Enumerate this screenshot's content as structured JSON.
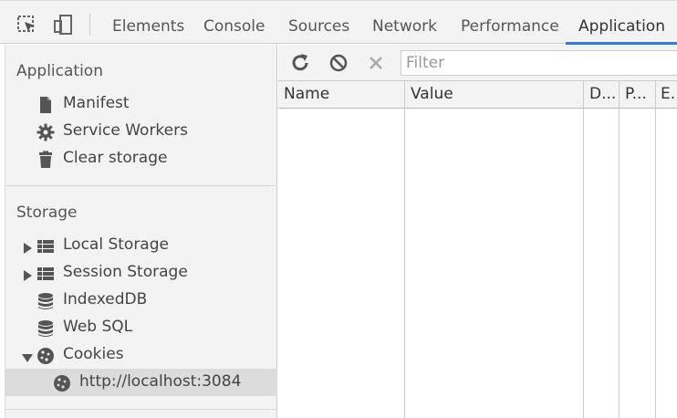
{
  "toolbar_icons": {
    "inspect": "inspect-element-icon",
    "device": "device-toolbar-icon"
  },
  "tabs": [
    {
      "label": "Elements"
    },
    {
      "label": "Console"
    },
    {
      "label": "Sources"
    },
    {
      "label": "Network"
    },
    {
      "label": "Performance"
    },
    {
      "label": "Application",
      "active": true
    }
  ],
  "sidebar": {
    "application_title": "Application",
    "application_items": [
      {
        "label": "Manifest",
        "icon": "document-icon"
      },
      {
        "label": "Service Workers",
        "icon": "gear-icon"
      },
      {
        "label": "Clear storage",
        "icon": "trash-icon"
      }
    ],
    "storage_title": "Storage",
    "storage_items": [
      {
        "label": "Local Storage",
        "icon": "table-icon",
        "expandable": true,
        "expanded": false
      },
      {
        "label": "Session Storage",
        "icon": "table-icon",
        "expandable": true,
        "expanded": false
      },
      {
        "label": "IndexedDB",
        "icon": "database-icon"
      },
      {
        "label": "Web SQL",
        "icon": "database-icon"
      },
      {
        "label": "Cookies",
        "icon": "cookie-icon",
        "expandable": true,
        "expanded": true
      },
      {
        "label": "http://localhost:3084",
        "icon": "cookie-icon",
        "selected": true
      }
    ]
  },
  "cookies_toolbar": {
    "filter_placeholder": "Filter",
    "refresh": "refresh-icon",
    "clear": "clear-all-icon",
    "delete": "delete-icon"
  },
  "table": {
    "columns": [
      "Name",
      "Value",
      "D...",
      "P...",
      "E..."
    ],
    "rows": []
  },
  "colors": {
    "accent": "#3879d9",
    "panel_bg": "#f3f3f3",
    "selected_bg": "#dcdcdc"
  }
}
